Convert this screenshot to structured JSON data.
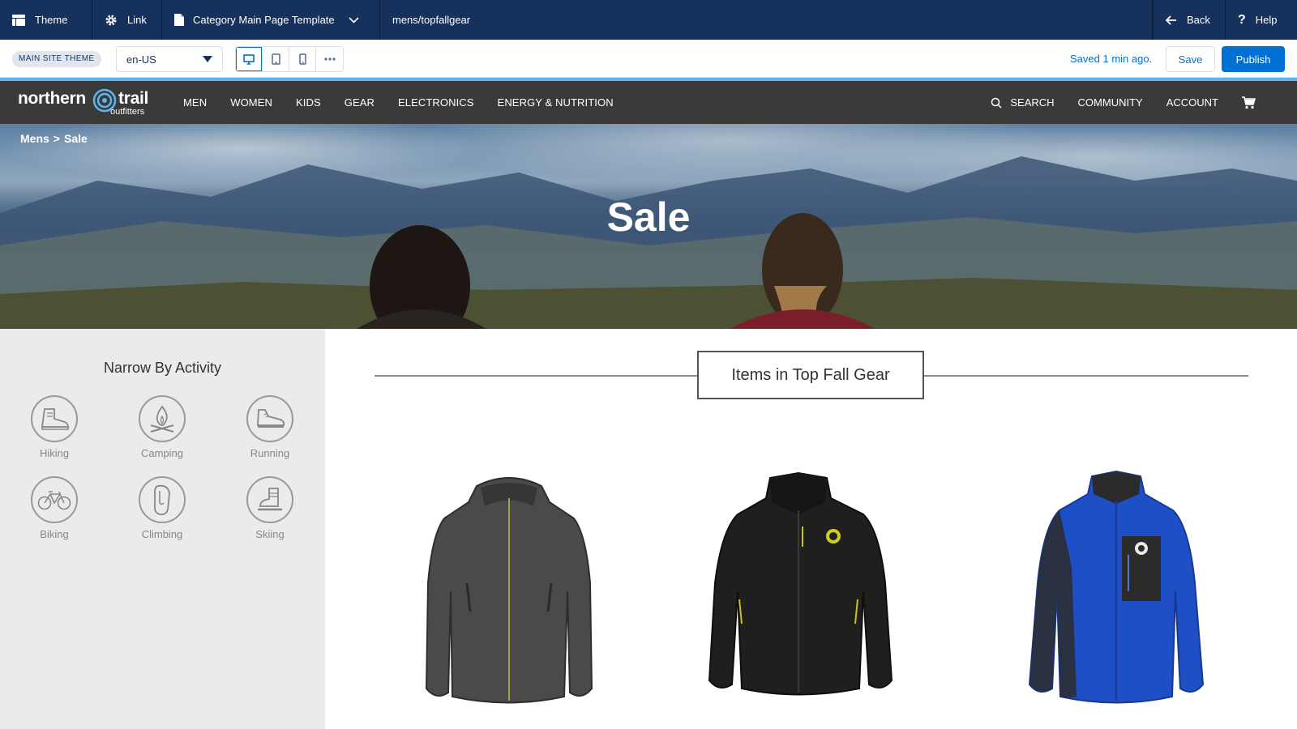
{
  "builder": {
    "topbar": {
      "theme_label": "Theme",
      "link_label": "Link",
      "template_label": "Category Main Page Template",
      "url_label": "mens/topfallgear",
      "back_label": "Back",
      "help_label": "Help"
    },
    "toolbar": {
      "theme_badge": "MAIN SITE THEME",
      "locale": "en-US",
      "saved_status": "Saved 1 min ago.",
      "save_label": "Save",
      "publish_label": "Publish"
    }
  },
  "site": {
    "logo": {
      "word1": "northern",
      "word2": "trail",
      "word3": "outfitters"
    },
    "nav": {
      "links": [
        "MEN",
        "WOMEN",
        "KIDS",
        "GEAR",
        "ELECTRONICS",
        "ENERGY & NUTRITION"
      ],
      "search_label": "SEARCH",
      "community_label": "COMMUNITY",
      "account_label": "ACCOUNT"
    },
    "breadcrumb": {
      "parent": "Mens",
      "separator": ">",
      "current": "Sale"
    },
    "hero_title": "Sale",
    "sidebar": {
      "title": "Narrow By Activity",
      "activities": [
        {
          "label": "Hiking",
          "icon": "hiking-boot-icon"
        },
        {
          "label": "Camping",
          "icon": "campfire-icon"
        },
        {
          "label": "Running",
          "icon": "running-shoe-icon"
        },
        {
          "label": "Biking",
          "icon": "bicycle-icon"
        },
        {
          "label": "Climbing",
          "icon": "carabiner-icon"
        },
        {
          "label": "Skiing",
          "icon": "ski-boot-icon"
        }
      ]
    },
    "section_title": "Items in Top Fall Gear",
    "products": [
      {
        "name": "grey-fleece-hoodie-jacket",
        "color": "#4a4a4a"
      },
      {
        "name": "black-softshell-jacket",
        "color": "#1f1f1f"
      },
      {
        "name": "blue-fleece-jacket",
        "color": "#1f4fc4"
      }
    ]
  },
  "colors": {
    "builder_bar": "#16325c",
    "accent_blue": "#0070d2",
    "site_nav": "#3a3a3a",
    "sidebar_bg": "#ebebeb"
  }
}
